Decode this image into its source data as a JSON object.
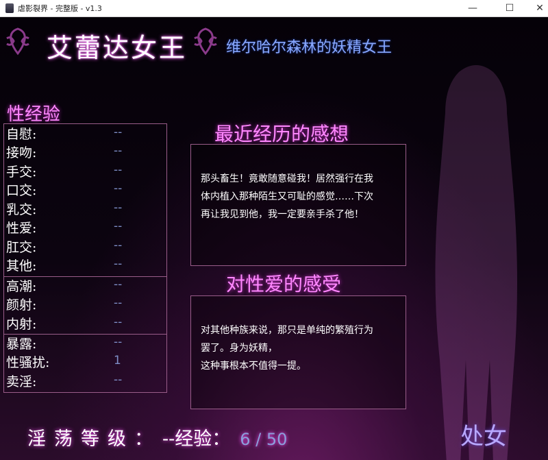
{
  "window": {
    "title": "虐影裂界 - 完整版 - v1.3",
    "minimize_icon": "minimize-icon",
    "maximize_icon": "maximize-icon",
    "close_icon": "close-icon"
  },
  "header": {
    "name": "艾蕾达女王",
    "subtitle": "维尔哈尔森林的妖精女王",
    "ornament_icon": "ornament-icon"
  },
  "stats": {
    "title": "性经验",
    "groups": [
      [
        {
          "label": "自慰:",
          "value": "--"
        },
        {
          "label": "接吻:",
          "value": "--"
        },
        {
          "label": "手交:",
          "value": "--"
        },
        {
          "label": "口交:",
          "value": "--"
        },
        {
          "label": "乳交:",
          "value": "--"
        },
        {
          "label": "性爱:",
          "value": "--"
        },
        {
          "label": "肛交:",
          "value": "--"
        },
        {
          "label": "其他:",
          "value": "--"
        }
      ],
      [
        {
          "label": "高潮:",
          "value": "--"
        },
        {
          "label": "颜射:",
          "value": "--"
        },
        {
          "label": "内射:",
          "value": "--"
        }
      ],
      [
        {
          "label": "暴露:",
          "value": "--"
        },
        {
          "label": "性骚扰:",
          "value": "1"
        },
        {
          "label": "卖淫:",
          "value": "--"
        }
      ]
    ]
  },
  "recent": {
    "title": "最近经历的感想",
    "lines": [
      "那头畜生！竟敢随意碰我！居然强行在我",
      "体内植入那种陌生又可耻的感觉……下次",
      "再让我见到他，我一定要亲手杀了他！"
    ]
  },
  "feeling": {
    "title": "对性爱的感受",
    "lines": [
      "对其他种族来说，那只是单纯的繁殖行为",
      "罢了。身为妖精，",
      "这种事根本不值得一提。"
    ]
  },
  "footer": {
    "level_label": "淫荡等级：",
    "level_value": "--",
    "exp_label": "经验：",
    "exp_value": "6 / 50"
  },
  "status": "处女",
  "colors": {
    "accent_pink": "#ff88ff",
    "value_blue": "#7f8fc8",
    "subtitle_blue": "#88a8ff",
    "border": "#9a5d8a"
  }
}
